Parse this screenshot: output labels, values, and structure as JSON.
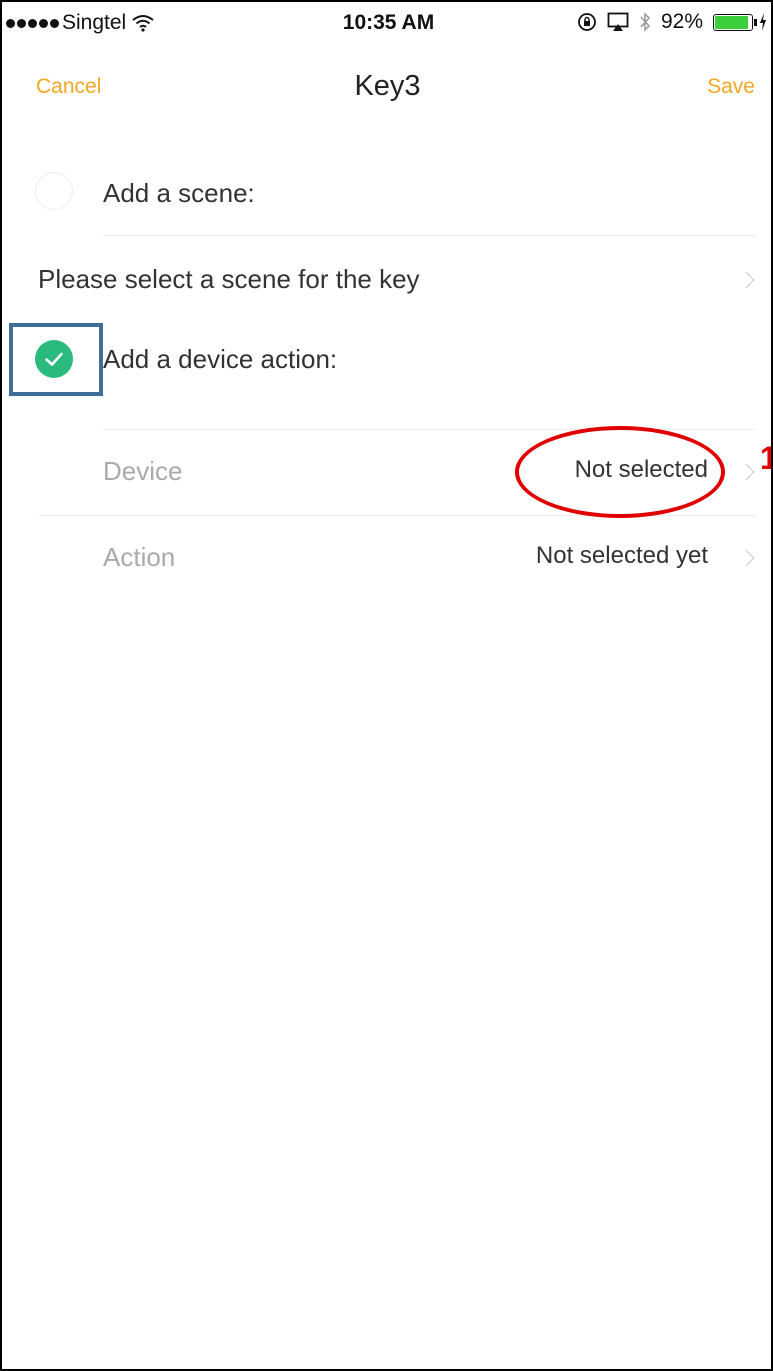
{
  "status_bar": {
    "carrier": "Singtel",
    "time": "10:35 AM",
    "battery": "92%",
    "battery_level": 0.92,
    "icons": [
      "signal-dots-icon",
      "wifi-icon",
      "orientation-lock-icon",
      "airplay-icon",
      "bluetooth-icon",
      "battery-icon",
      "charging-icon"
    ]
  },
  "nav": {
    "cancel_label": "Cancel",
    "title": "Key3",
    "save_label": "Save"
  },
  "scene_section": {
    "label": "Add a scene:",
    "checked": false,
    "select_prompt": "Please select a scene for the key"
  },
  "device_section": {
    "label": "Add a device action:",
    "checked": true,
    "rows": [
      {
        "label": "Device",
        "value": "Not selected"
      },
      {
        "label": "Action",
        "value": "Not selected yet"
      }
    ]
  },
  "annotation": {
    "number": "1"
  },
  "colors": {
    "accent": "#f5a623",
    "check": "#2bba7e",
    "highlight_box": "#3f6d9a",
    "highlight_ellipse": "#e00000"
  }
}
